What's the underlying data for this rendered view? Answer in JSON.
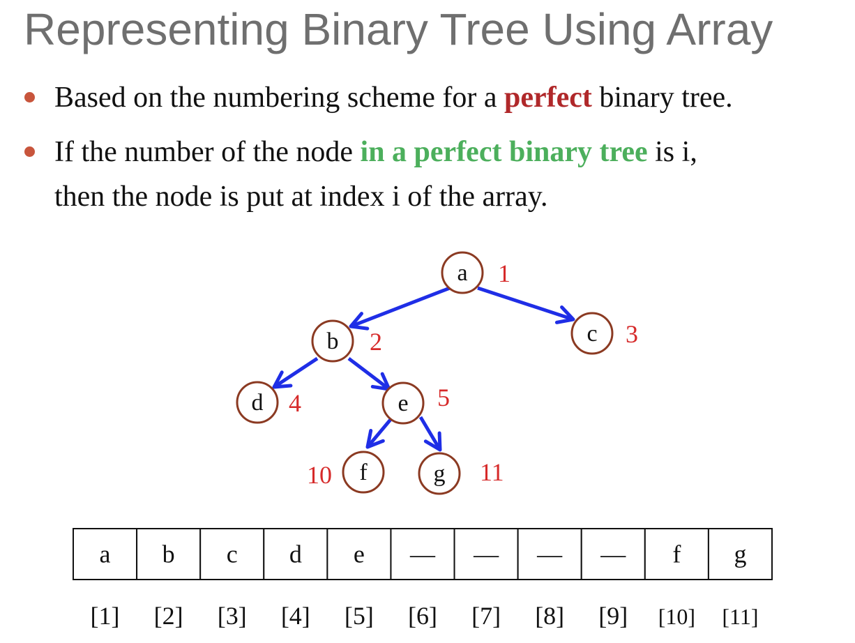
{
  "slide": {
    "title": "Representing Binary Tree Using Array",
    "bullets": [
      {
        "pre": "Based on the numbering scheme for a ",
        "highlight": "perfect",
        "post": " binary tree."
      },
      {
        "pre": "If the number of the node ",
        "highlight": "in a perfect binary tree",
        "post": " is i,",
        "continuation": "then the node is put at index i of the array."
      }
    ]
  },
  "tree": {
    "nodes": [
      {
        "id": "a",
        "label": "a",
        "number": "1"
      },
      {
        "id": "b",
        "label": "b",
        "number": "2"
      },
      {
        "id": "c",
        "label": "c",
        "number": "3"
      },
      {
        "id": "d",
        "label": "d",
        "number": "4"
      },
      {
        "id": "e",
        "label": "e",
        "number": "5"
      },
      {
        "id": "f",
        "label": "f",
        "number": "10"
      },
      {
        "id": "g",
        "label": "g",
        "number": "11"
      }
    ],
    "edges": [
      {
        "from": "a",
        "to": "b"
      },
      {
        "from": "a",
        "to": "c"
      },
      {
        "from": "b",
        "to": "d"
      },
      {
        "from": "b",
        "to": "e"
      },
      {
        "from": "e",
        "to": "f"
      },
      {
        "from": "e",
        "to": "g"
      }
    ]
  },
  "array": {
    "cells": [
      "a",
      "b",
      "c",
      "d",
      "e",
      "—",
      "—",
      "—",
      "—",
      "f",
      "g"
    ],
    "indices": [
      "[1]",
      "[2]",
      "[3]",
      "[4]",
      "[5]",
      "[6]",
      "[7]",
      "[8]",
      "[9]",
      "[10]",
      "[11]"
    ]
  },
  "colors": {
    "title": "#6f6f6f",
    "bullet_dot": "#c8553c",
    "highlight_red": "#b0282a",
    "highlight_green": "#4caf5c",
    "node_stroke": "#8b3a22",
    "node_number": "#d62a2a",
    "edge": "#1f2ee6"
  }
}
